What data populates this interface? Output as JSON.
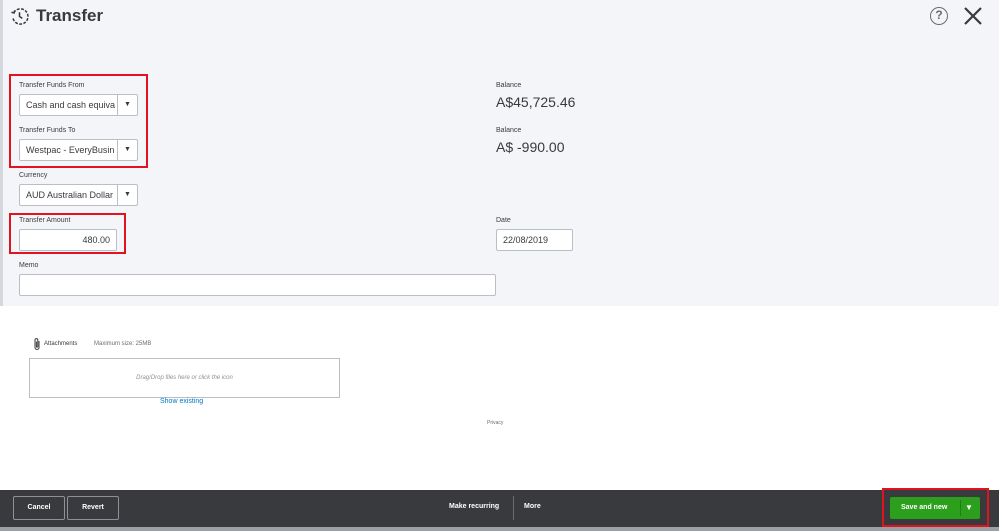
{
  "header": {
    "title": "Transfer",
    "help_label": "?"
  },
  "form": {
    "from": {
      "label": "Transfer Funds From",
      "value": "Cash and cash equiva",
      "balance_label": "Balance",
      "balance": "A$45,725.46"
    },
    "to": {
      "label": "Transfer Funds To",
      "value": "Westpac - EveryBusin",
      "balance_label": "Balance",
      "balance": "A$ -990.00"
    },
    "currency": {
      "label": "Currency",
      "value": "AUD Australian Dollar"
    },
    "amount": {
      "label": "Transfer Amount",
      "value": "480.00"
    },
    "date": {
      "label": "Date",
      "value": "22/08/2019"
    },
    "memo": {
      "label": "Memo",
      "value": ""
    }
  },
  "attachments": {
    "label": "Attachments",
    "max_size": "Maximum size: 25MB",
    "dropzone_text": "Drag/Drop files here or click the icon",
    "show_existing": "Show existing"
  },
  "privacy": "Privacy",
  "footer": {
    "cancel": "Cancel",
    "revert": "Revert",
    "make_recurring": "Make recurring",
    "more": "More",
    "save_and_new": "Save and new"
  },
  "colors": {
    "primary_green": "#2ca01c",
    "footer_bg": "#393a3d",
    "highlight_red": "#e0131e",
    "link_blue": "#0077c5"
  },
  "icons": [
    "history-clock-icon",
    "help-icon",
    "close-icon",
    "chevron-down-icon",
    "paperclip-icon"
  ]
}
